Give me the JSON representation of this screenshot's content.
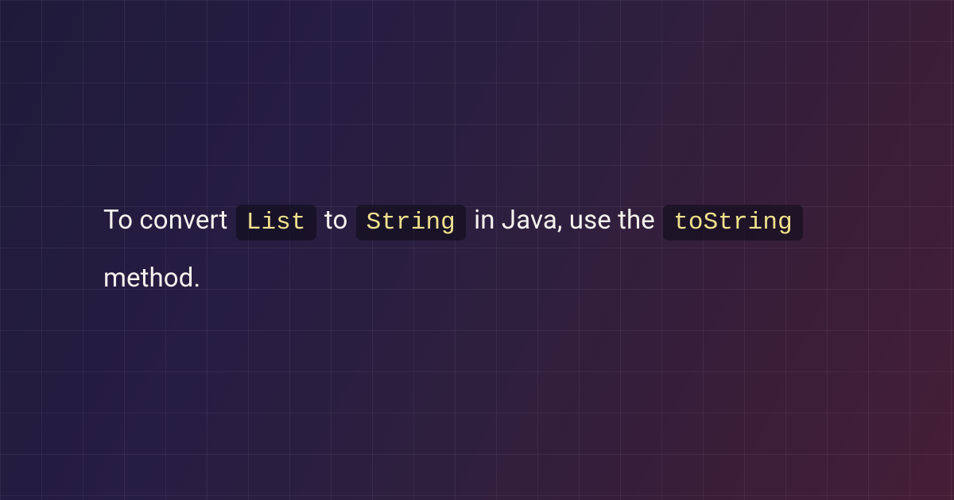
{
  "sentence": {
    "prefix": "To convert ",
    "code1": "List",
    "mid1": " to ",
    "code2": "String",
    "mid2": " in Java, use the ",
    "code3": "toString",
    "suffix": " method."
  }
}
